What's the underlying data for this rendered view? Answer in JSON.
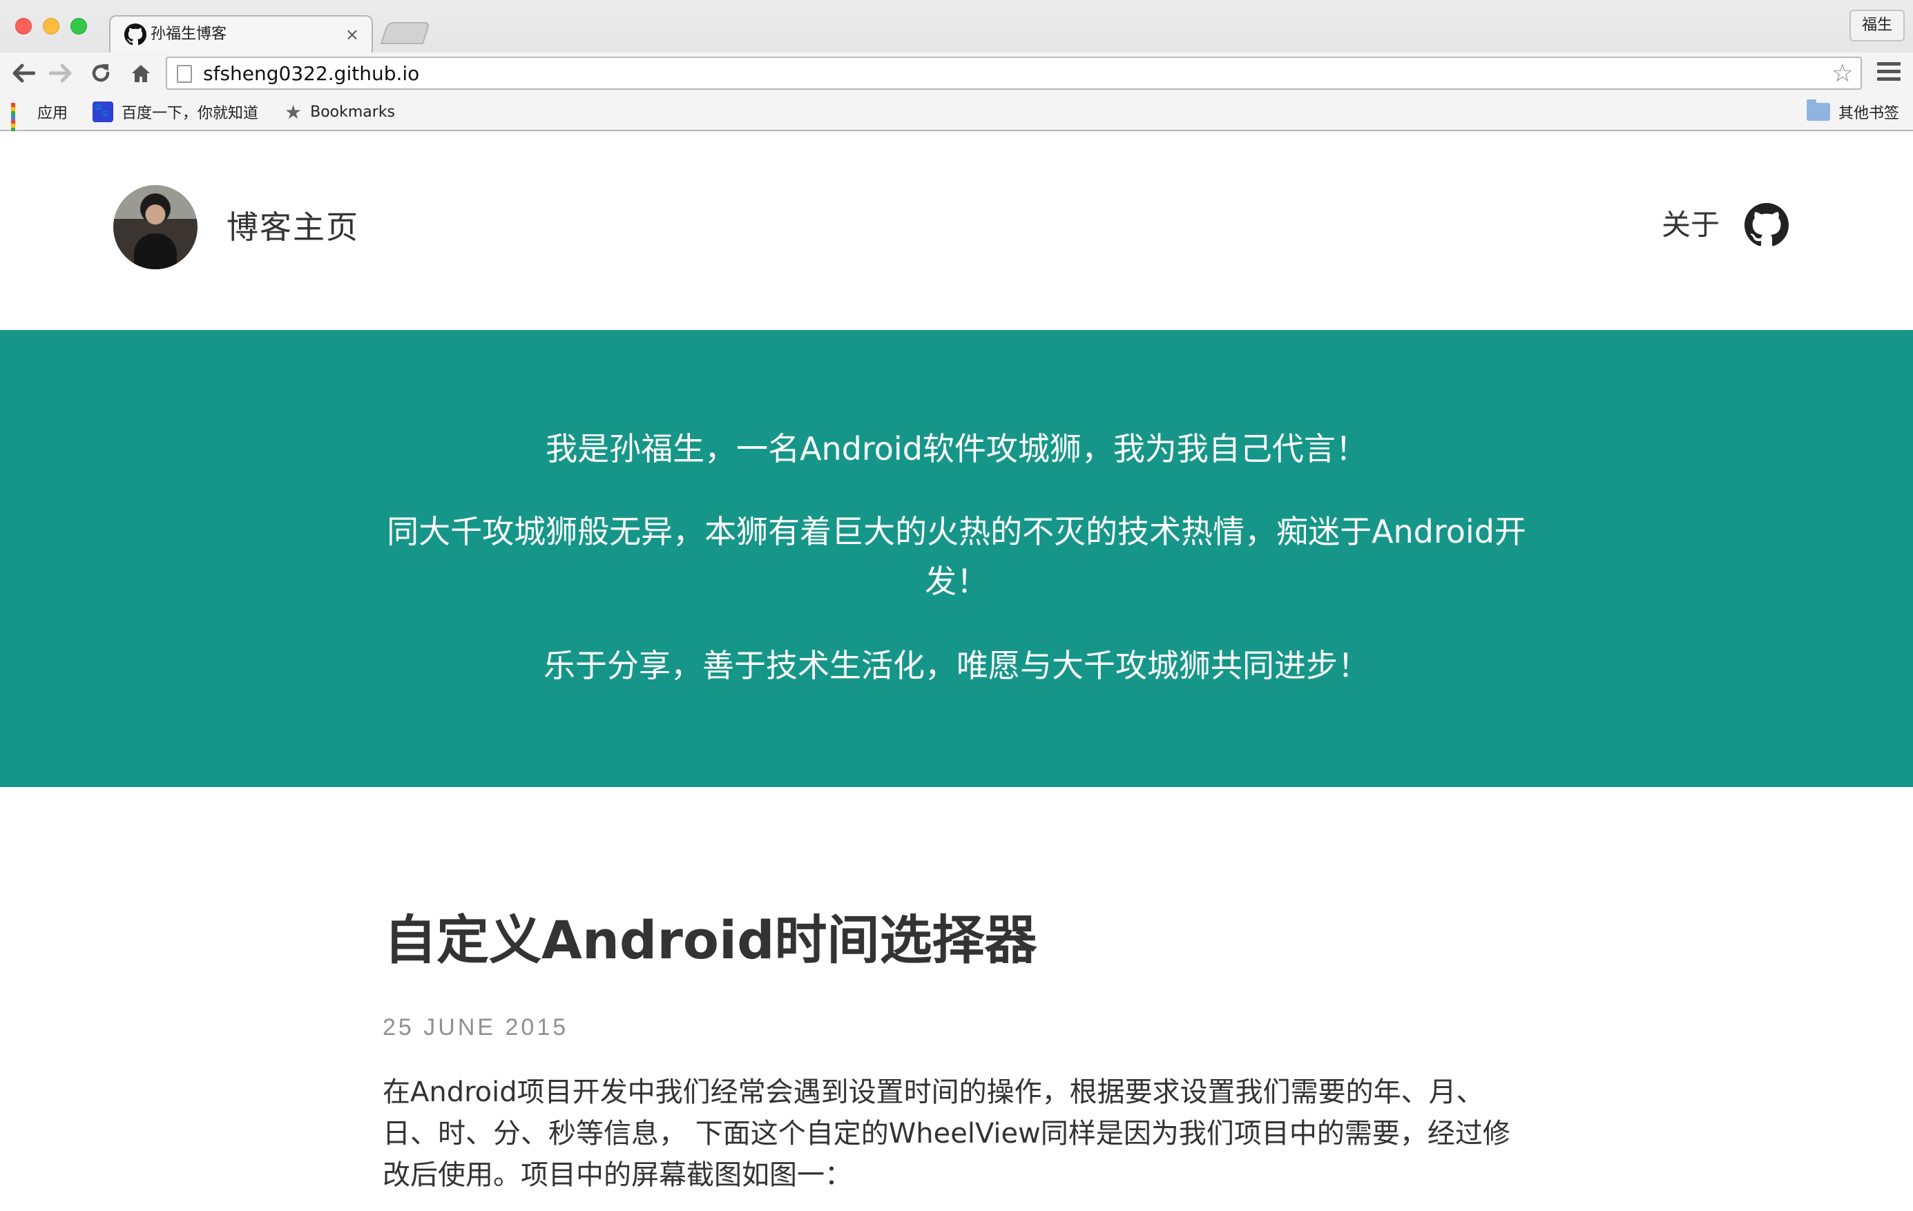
{
  "browser": {
    "tab_title": "孙福生博客",
    "tab_close": "×",
    "profile_name": "福生",
    "url": "sfsheng0322.github.io",
    "bookmarks": {
      "apps": "应用",
      "baidu": "百度一下，你就知道",
      "bookmarks": "Bookmarks",
      "other": "其他书签"
    }
  },
  "site": {
    "title": "博客主页",
    "nav_about": "关于"
  },
  "hero": {
    "line1": "我是孙福生，一名Android软件攻城狮，我为我自己代言！",
    "line2": "同大千攻城狮般无异，本狮有着巨大的火热的不灭的技术热情，痴迷于Android开发！",
    "line3": "乐于分享，善于技术生活化，唯愿与大千攻城狮共同进步！"
  },
  "post": {
    "title": "自定义Android时间选择器",
    "date": "25 JUNE 2015",
    "excerpt": "在Android项目开发中我们经常会遇到设置时间的操作，根据要求设置我们需要的年、月、日、时、分、秒等信息， 下面这个自定的WheelView同样是因为我们项目中的需要，经过修改后使用。项目中的屏幕截图如图一："
  },
  "colors": {
    "hero_bg": "#169688",
    "hero_text": "#ffffff",
    "title_text": "#333333",
    "date_text": "#909090"
  },
  "icons": [
    "github-icon",
    "back-arrow-icon",
    "forward-arrow-icon",
    "reload-icon",
    "home-icon",
    "star-icon",
    "menu-icon",
    "apps-icon",
    "baidu-icon",
    "folder-icon"
  ]
}
